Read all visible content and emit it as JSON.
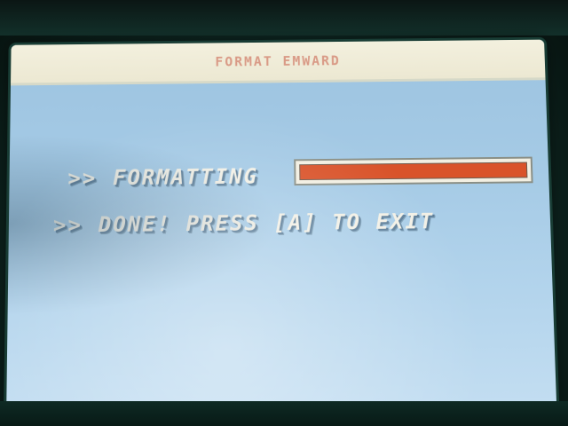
{
  "header": {
    "title": "FORMAT EMWARD"
  },
  "status": {
    "formatting_arrow": ">>",
    "formatting_label": "FORMATTING",
    "progress": 1.0,
    "progress_color": "#d9532a",
    "done_arrow": ">>",
    "done_message": "DONE! PRESS [A] TO EXIT"
  },
  "colors": {
    "screen_bg": "#a6cbe6",
    "titlebar_bg": "#f0eddb",
    "text": "#f2f0e6"
  }
}
